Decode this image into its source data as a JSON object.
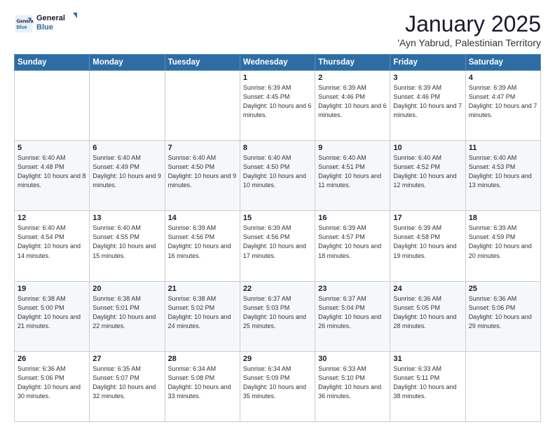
{
  "logo": {
    "line1": "General",
    "line2": "Blue"
  },
  "title": "January 2025",
  "location": "'Ayn Yabrud, Palestinian Territory",
  "weekdays": [
    "Sunday",
    "Monday",
    "Tuesday",
    "Wednesday",
    "Thursday",
    "Friday",
    "Saturday"
  ],
  "weeks": [
    [
      {
        "day": "",
        "info": ""
      },
      {
        "day": "",
        "info": ""
      },
      {
        "day": "",
        "info": ""
      },
      {
        "day": "1",
        "info": "Sunrise: 6:39 AM\nSunset: 4:45 PM\nDaylight: 10 hours\nand 6 minutes."
      },
      {
        "day": "2",
        "info": "Sunrise: 6:39 AM\nSunset: 4:46 PM\nDaylight: 10 hours\nand 6 minutes."
      },
      {
        "day": "3",
        "info": "Sunrise: 6:39 AM\nSunset: 4:46 PM\nDaylight: 10 hours\nand 7 minutes."
      },
      {
        "day": "4",
        "info": "Sunrise: 6:39 AM\nSunset: 4:47 PM\nDaylight: 10 hours\nand 7 minutes."
      }
    ],
    [
      {
        "day": "5",
        "info": "Sunrise: 6:40 AM\nSunset: 4:48 PM\nDaylight: 10 hours\nand 8 minutes."
      },
      {
        "day": "6",
        "info": "Sunrise: 6:40 AM\nSunset: 4:49 PM\nDaylight: 10 hours\nand 9 minutes."
      },
      {
        "day": "7",
        "info": "Sunrise: 6:40 AM\nSunset: 4:50 PM\nDaylight: 10 hours\nand 9 minutes."
      },
      {
        "day": "8",
        "info": "Sunrise: 6:40 AM\nSunset: 4:50 PM\nDaylight: 10 hours\nand 10 minutes."
      },
      {
        "day": "9",
        "info": "Sunrise: 6:40 AM\nSunset: 4:51 PM\nDaylight: 10 hours\nand 11 minutes."
      },
      {
        "day": "10",
        "info": "Sunrise: 6:40 AM\nSunset: 4:52 PM\nDaylight: 10 hours\nand 12 minutes."
      },
      {
        "day": "11",
        "info": "Sunrise: 6:40 AM\nSunset: 4:53 PM\nDaylight: 10 hours\nand 13 minutes."
      }
    ],
    [
      {
        "day": "12",
        "info": "Sunrise: 6:40 AM\nSunset: 4:54 PM\nDaylight: 10 hours\nand 14 minutes."
      },
      {
        "day": "13",
        "info": "Sunrise: 6:40 AM\nSunset: 4:55 PM\nDaylight: 10 hours\nand 15 minutes."
      },
      {
        "day": "14",
        "info": "Sunrise: 6:39 AM\nSunset: 4:56 PM\nDaylight: 10 hours\nand 16 minutes."
      },
      {
        "day": "15",
        "info": "Sunrise: 6:39 AM\nSunset: 4:56 PM\nDaylight: 10 hours\nand 17 minutes."
      },
      {
        "day": "16",
        "info": "Sunrise: 6:39 AM\nSunset: 4:57 PM\nDaylight: 10 hours\nand 18 minutes."
      },
      {
        "day": "17",
        "info": "Sunrise: 6:39 AM\nSunset: 4:58 PM\nDaylight: 10 hours\nand 19 minutes."
      },
      {
        "day": "18",
        "info": "Sunrise: 6:39 AM\nSunset: 4:59 PM\nDaylight: 10 hours\nand 20 minutes."
      }
    ],
    [
      {
        "day": "19",
        "info": "Sunrise: 6:38 AM\nSunset: 5:00 PM\nDaylight: 10 hours\nand 21 minutes."
      },
      {
        "day": "20",
        "info": "Sunrise: 6:38 AM\nSunset: 5:01 PM\nDaylight: 10 hours\nand 22 minutes."
      },
      {
        "day": "21",
        "info": "Sunrise: 6:38 AM\nSunset: 5:02 PM\nDaylight: 10 hours\nand 24 minutes."
      },
      {
        "day": "22",
        "info": "Sunrise: 6:37 AM\nSunset: 5:03 PM\nDaylight: 10 hours\nand 25 minutes."
      },
      {
        "day": "23",
        "info": "Sunrise: 6:37 AM\nSunset: 5:04 PM\nDaylight: 10 hours\nand 26 minutes."
      },
      {
        "day": "24",
        "info": "Sunrise: 6:36 AM\nSunset: 5:05 PM\nDaylight: 10 hours\nand 28 minutes."
      },
      {
        "day": "25",
        "info": "Sunrise: 6:36 AM\nSunset: 5:06 PM\nDaylight: 10 hours\nand 29 minutes."
      }
    ],
    [
      {
        "day": "26",
        "info": "Sunrise: 6:36 AM\nSunset: 5:06 PM\nDaylight: 10 hours\nand 30 minutes."
      },
      {
        "day": "27",
        "info": "Sunrise: 6:35 AM\nSunset: 5:07 PM\nDaylight: 10 hours\nand 32 minutes."
      },
      {
        "day": "28",
        "info": "Sunrise: 6:34 AM\nSunset: 5:08 PM\nDaylight: 10 hours\nand 33 minutes."
      },
      {
        "day": "29",
        "info": "Sunrise: 6:34 AM\nSunset: 5:09 PM\nDaylight: 10 hours\nand 35 minutes."
      },
      {
        "day": "30",
        "info": "Sunrise: 6:33 AM\nSunset: 5:10 PM\nDaylight: 10 hours\nand 36 minutes."
      },
      {
        "day": "31",
        "info": "Sunrise: 6:33 AM\nSunset: 5:11 PM\nDaylight: 10 hours\nand 38 minutes."
      },
      {
        "day": "",
        "info": ""
      }
    ]
  ]
}
